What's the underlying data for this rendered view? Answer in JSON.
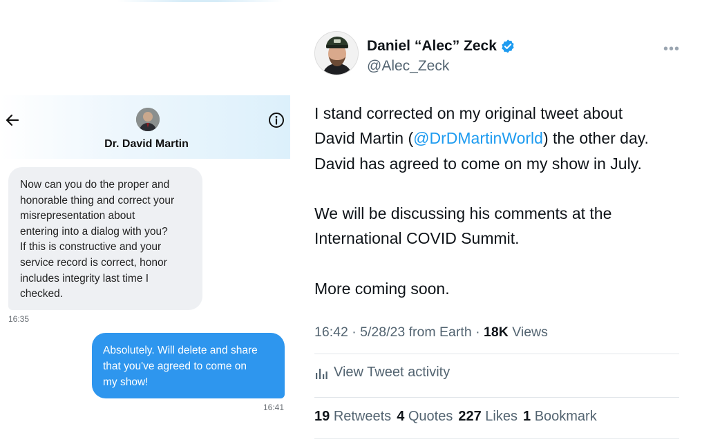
{
  "dm": {
    "contact_name": "Dr. David Martin",
    "incoming": {
      "lines": [
        "Now can you do the proper and",
        "honorable thing and correct your",
        "misrepresentation about",
        "entering into a dialog with you?",
        "If this is constructive and your",
        "service record is correct, honor",
        "includes integrity last time I",
        "checked."
      ],
      "time": "16:35"
    },
    "outgoing": {
      "lines": [
        "Absolutely. Will delete and share",
        "that you've agreed to come on",
        "my show!"
      ],
      "time": "16:41"
    },
    "icons": {
      "back": "arrow-left-icon",
      "info": "info-icon"
    }
  },
  "tweet": {
    "author_name": "Daniel “Alec” Zeck",
    "handle": "@Alec_Zeck",
    "body": {
      "line1": "I stand corrected on my original tweet about",
      "line2_pre": "David Martin (",
      "mention": "@DrDMartinWorld",
      "line2_post": ") the other day.",
      "line3": "David has agreed to come on my show in July.",
      "line4": "We will be discussing his comments at the",
      "line5": "International COVID Summit.",
      "line6": "More coming soon."
    },
    "meta": {
      "time": "16:42",
      "sep1": " · ",
      "date": "5/28/23",
      "source": " from Earth",
      "sep2": " · ",
      "views_count": "18K",
      "views_label": " Views"
    },
    "activity_label": "View Tweet activity",
    "stats": {
      "retweets_count": "19",
      "retweets_label": "Retweets",
      "quotes_count": "4",
      "quotes_label": "Quotes",
      "likes_count": "227",
      "likes_label": "Likes",
      "bookmarks_count": "1",
      "bookmarks_label": "Bookmark"
    },
    "colors": {
      "link": "#1d9bf0",
      "verified": "#1d9bf0",
      "secondary": "#536471"
    }
  }
}
